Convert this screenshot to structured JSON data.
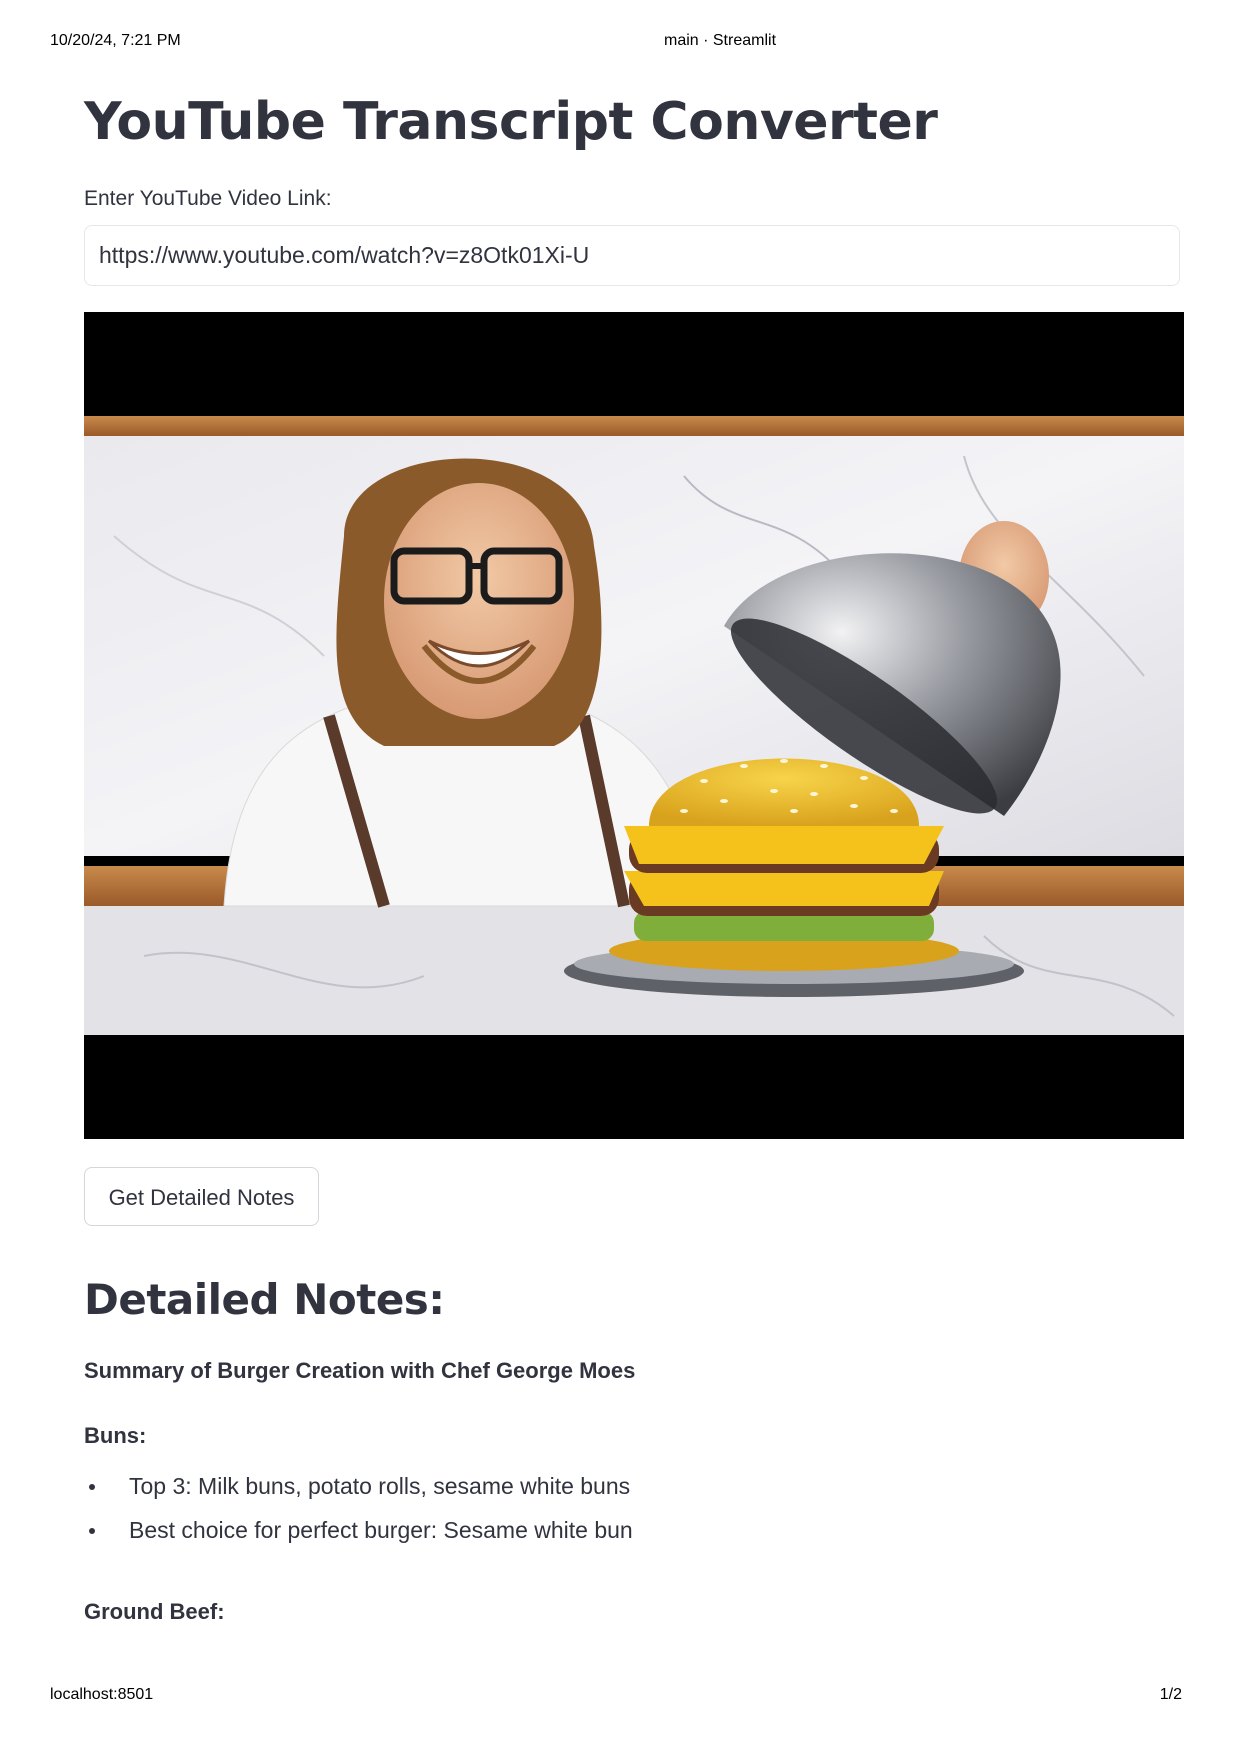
{
  "print_header": {
    "datetime": "10/20/24, 7:21 PM",
    "page_title": "main · Streamlit"
  },
  "print_footer": {
    "url": "localhost:8501",
    "page": "1/2"
  },
  "app": {
    "title": "YouTube Transcript Converter",
    "input_label": "Enter YouTube Video Link:",
    "input_value": "https://www.youtube.com/watch?v=z8Otk01Xi-U",
    "button_label": "Get Detailed Notes",
    "notes_heading": "Detailed Notes:",
    "summary_title": "Summary of Burger Creation with Chef George Moes",
    "sections": [
      {
        "heading": "Buns:",
        "bullets": [
          "Top 3: Milk buns, potato rolls, sesame white buns",
          "Best choice for perfect burger: Sesame white bun"
        ]
      },
      {
        "heading": "Ground Beef:",
        "bullets": []
      }
    ]
  },
  "colors": {
    "text": "#31333f",
    "border": "#e6e7ea",
    "video_bg": "#000000"
  }
}
